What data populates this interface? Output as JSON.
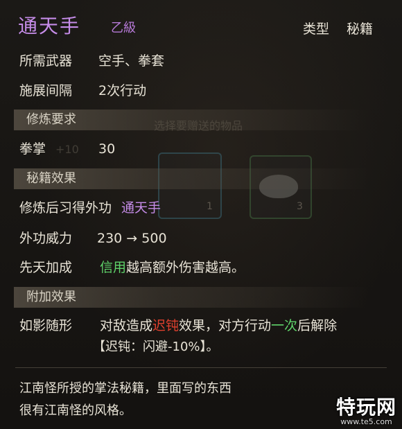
{
  "header": {
    "title": "通天手",
    "grade": "乙級",
    "type_label": "类型",
    "type_value": "秘籍"
  },
  "info": {
    "weapon_label": "所需武器",
    "weapon_value": "空手、拳套",
    "interval_label": "施展间隔",
    "interval_value": "2次行动"
  },
  "sections": {
    "requirement": "修炼要求",
    "effect": "秘籍效果",
    "extra": "附加效果"
  },
  "requirement": {
    "label": "拳掌",
    "value": "30"
  },
  "effect": {
    "learn_label": "修炼后习得外功",
    "learn_value": "通天手",
    "power_label": "外功威力",
    "power_value": "230 → 500",
    "innate_label": "先天加成",
    "innate_attr": "信用",
    "innate_text": "越高额外伤害越高。"
  },
  "extra": {
    "name": "如影随形",
    "text_1": "对敌造成",
    "status": "迟钝",
    "text_2": "效果，对方行动",
    "count": "一次",
    "text_3": "后解除",
    "detail": "【迟钝：闪避-10%】。"
  },
  "description": {
    "line_1": "江南怪所授的掌法秘籍，里面写的东西",
    "line_2": "很有江南怪的风格。"
  },
  "background_dialog": {
    "prompt": "选择要赠送的物品",
    "bonus": "+10",
    "slot_1_count": "1",
    "slot_2_count": "3"
  },
  "watermark": {
    "brand": "特玩网",
    "domain": "www.te5.com"
  }
}
